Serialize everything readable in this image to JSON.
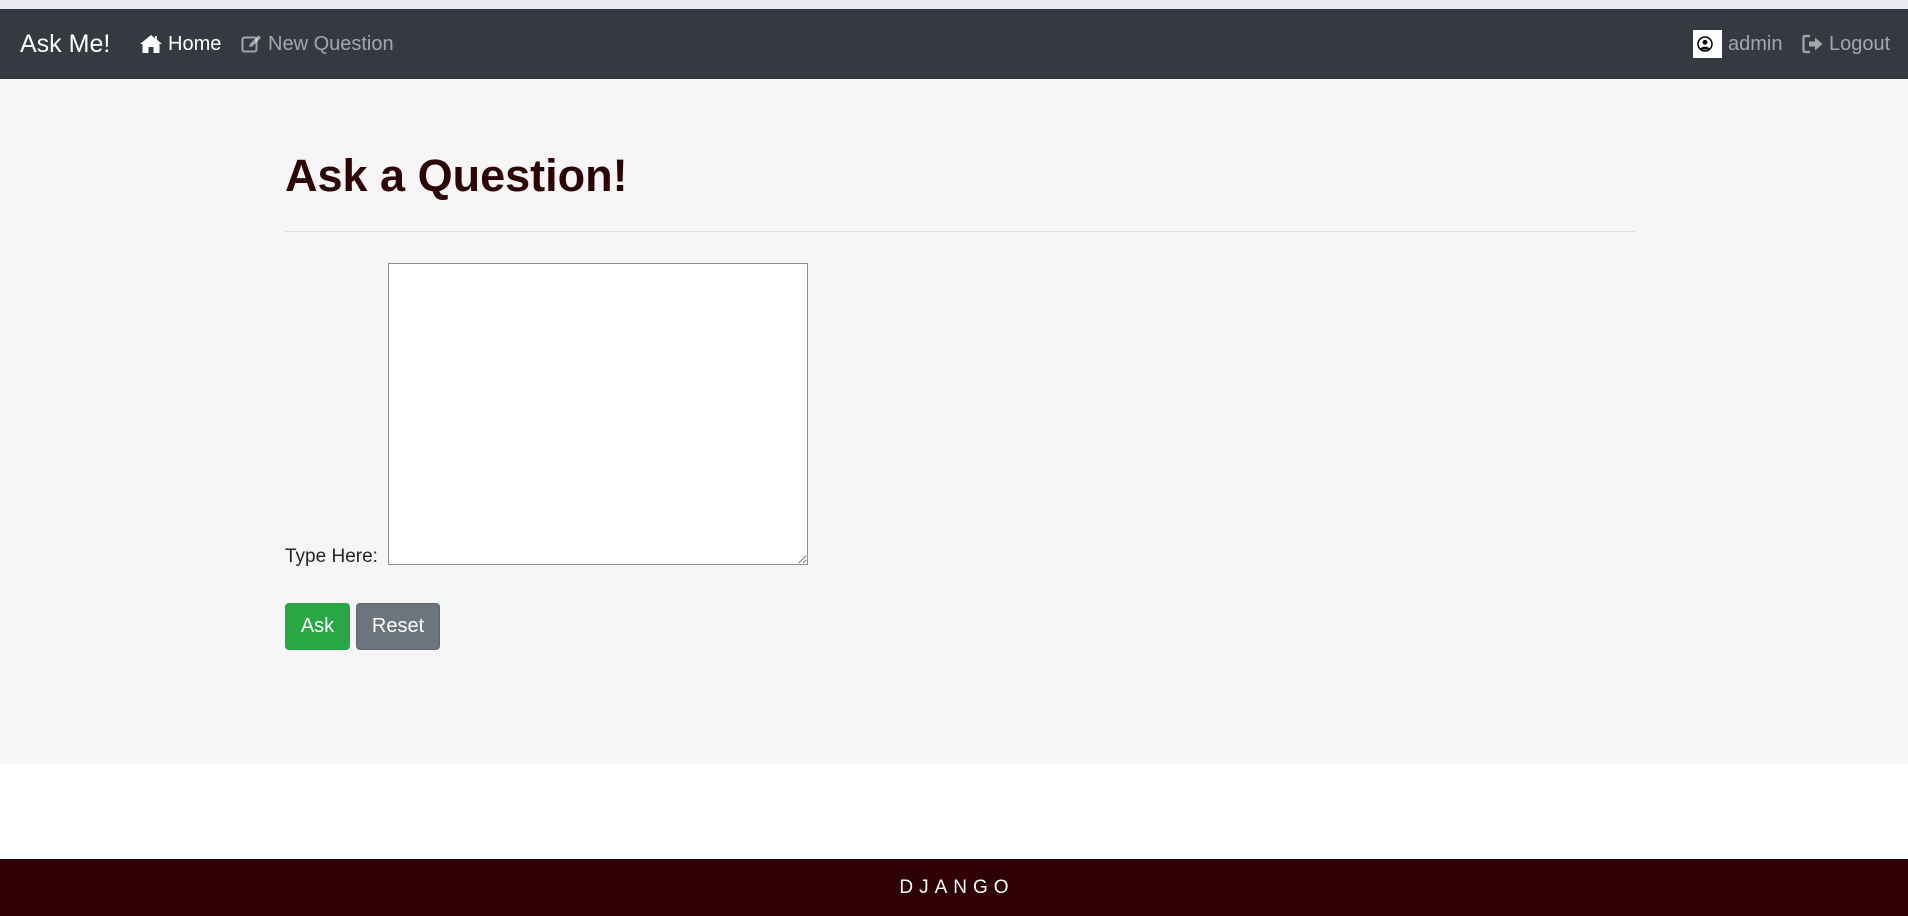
{
  "navbar": {
    "brand": "Ask Me!",
    "home_label": "Home",
    "new_question_label": "New Question",
    "user_label": "admin",
    "logout_label": "Logout"
  },
  "main": {
    "title": "Ask a Question!",
    "field_label": "Type Here:",
    "textarea_value": "",
    "ask_label": "Ask",
    "reset_label": "Reset"
  },
  "footer": {
    "text": "DJANGO"
  },
  "colors": {
    "navbar_bg": "#343a40",
    "title": "#2e0306",
    "ask_button": "#28a745",
    "reset_button": "#6c757d",
    "footer_bg": "#2e0003"
  },
  "icons": {
    "home": "home-icon",
    "new_question": "edit-icon",
    "user": "user-circle-icon",
    "logout": "sign-out-icon"
  }
}
